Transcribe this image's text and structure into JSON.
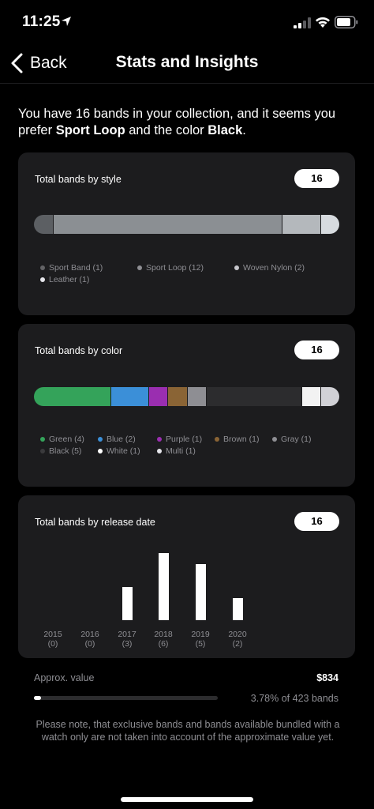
{
  "status": {
    "time": "11:25"
  },
  "nav": {
    "back_label": "Back",
    "title": "Stats and Insights"
  },
  "intro": {
    "part1": "You have 16 bands in your collection, and it seems you prefer ",
    "style": "Sport Loop",
    "part2": " and the color ",
    "color": "Black",
    "part3": "."
  },
  "style_card": {
    "title": "Total bands by style",
    "count": "16",
    "segments": [
      {
        "name": "Sport Band",
        "value": 1,
        "color": "#5c5f63"
      },
      {
        "name": "Sport Loop",
        "value": 12,
        "color": "#8b8f93"
      },
      {
        "name": "Woven Nylon",
        "value": 2,
        "color": "#b4b8bc"
      },
      {
        "name": "Leather",
        "value": 1,
        "color": "#d7dbdf"
      }
    ],
    "legend": [
      "Sport Band (1)",
      "Sport Loop (12)",
      "Woven Nylon (2)",
      "Leather (1)"
    ],
    "legend_colors": [
      "#636366",
      "#8e8e93",
      "#c7c7cc",
      "#e5e5ea"
    ]
  },
  "color_card": {
    "title": "Total bands by color",
    "count": "16",
    "segments": [
      {
        "name": "Green",
        "value": 4,
        "color": "#34a35a"
      },
      {
        "name": "Blue",
        "value": 2,
        "color": "#3b8fd8"
      },
      {
        "name": "Purple",
        "value": 1,
        "color": "#9a2eb0"
      },
      {
        "name": "Brown",
        "value": 1,
        "color": "#8a6435"
      },
      {
        "name": "Gray",
        "value": 1,
        "color": "#8e8e93"
      },
      {
        "name": "Black",
        "value": 5,
        "color": "#2c2c2e"
      },
      {
        "name": "White",
        "value": 1,
        "color": "#f2f2f2"
      },
      {
        "name": "Multi",
        "value": 1,
        "color": "#d1d1d6"
      }
    ],
    "legend": [
      "Green (4)",
      "Blue (2)",
      "Purple (1)",
      "Brown (1)",
      "Gray (1)",
      "Black (5)",
      "White (1)",
      "Multi (1)"
    ],
    "legend_colors": [
      "#34a35a",
      "#3b8fd8",
      "#9a2eb0",
      "#8a6435",
      "#8e8e93",
      "#3a3a3c",
      "#ffffff",
      "#e5e5ea"
    ]
  },
  "release_card": {
    "title": "Total bands by release date",
    "count": "16",
    "years": [
      "2015",
      "2016",
      "2017",
      "2018",
      "2019",
      "2020"
    ],
    "counts_label": [
      "(0)",
      "(0)",
      "(3)",
      "(6)",
      "(5)",
      "(2)"
    ]
  },
  "chart_data": {
    "type": "bar",
    "categories": [
      "2015",
      "2016",
      "2017",
      "2018",
      "2019",
      "2020"
    ],
    "values": [
      0,
      0,
      3,
      6,
      5,
      2
    ],
    "title": "Total bands by release date",
    "xlabel": "",
    "ylabel": ""
  },
  "approx": {
    "label": "Approx. value",
    "value": "$834",
    "progress_percent": 3.78,
    "progress_text": "3.78% of 423 bands",
    "note": "Please note, that exclusive bands and bands available bundled with a watch only are not taken into account of the approximate value yet."
  }
}
